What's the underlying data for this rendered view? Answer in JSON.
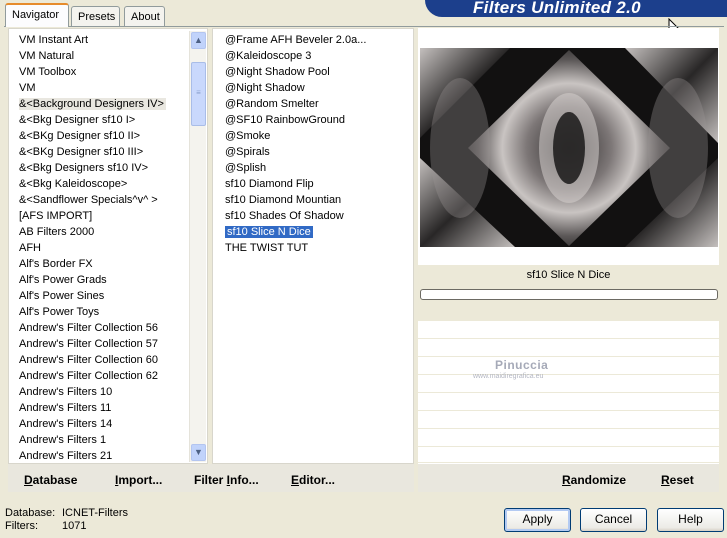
{
  "window": {
    "banner_title": "Filters Unlimited 2.0"
  },
  "tabs": [
    {
      "label": "Navigator",
      "active": true
    },
    {
      "label": "Presets",
      "active": false
    },
    {
      "label": "About",
      "active": false
    }
  ],
  "categories": [
    "VM Instant Art",
    "VM Natural",
    "VM Toolbox",
    "VM",
    "&<Background Designers IV>",
    "&<Bkg Designer sf10 I>",
    "&<BKg Designer sf10 II>",
    "&<BKg Designer sf10 III>",
    "&<Bkg Designers sf10 IV>",
    "&<Bkg Kaleidoscope>",
    "&<Sandflower Specials^v^ >",
    "[AFS IMPORT]",
    "AB Filters 2000",
    "AFH",
    "Alf's Border FX",
    "Alf's Power Grads",
    "Alf's Power Sines",
    "Alf's Power Toys",
    "Andrew's Filter Collection 56",
    "Andrew's Filter Collection 57",
    "Andrew's Filter Collection 60",
    "Andrew's Filter Collection 62",
    "Andrew's Filters 10",
    "Andrew's Filters 11",
    "Andrew's Filters 14",
    "Andrew's Filters 1",
    "Andrew's Filters 21"
  ],
  "filters": [
    "@Frame AFH Beveler 2.0a...",
    "@Kaleidoscope 3",
    "@Night Shadow Pool",
    "@Night Shadow",
    "@Random Smelter",
    "@SF10 RainbowGround",
    "@Smoke",
    "@Spirals",
    "@Splish",
    "sf10 Diamond Flip",
    "sf10 Diamond Mountian",
    "sf10 Shades Of Shadow",
    "sf10 Slice N Dice",
    "THE TWIST TUT"
  ],
  "selected_filter": "sf10 Slice N Dice",
  "preview": {
    "filter_name": "sf10 Slice N Dice",
    "progress": 0,
    "watermark_name": "Pinuccia",
    "watermark_url": "www.maidiregrafica.eu"
  },
  "commands": {
    "database": "Database",
    "import": "Import...",
    "filter_info": "Filter Info...",
    "editor": "Editor...",
    "randomize": "Randomize",
    "reset": "Reset"
  },
  "status": {
    "database_label": "Database:",
    "database_value": "ICNET-Filters",
    "filters_label": "Filters:",
    "filters_value": "1071"
  },
  "buttons": {
    "apply": "Apply",
    "cancel": "Cancel",
    "help": "Help"
  },
  "icons": {
    "scroll_up": "scroll-up-arrow-icon",
    "scroll_down": "scroll-down-arrow-icon",
    "cursor": "mouse-pointer-icon"
  },
  "colors": {
    "banner": "#1c3f8c",
    "selection": "#316ac5",
    "active_tab_accent": "#e68b2c"
  }
}
